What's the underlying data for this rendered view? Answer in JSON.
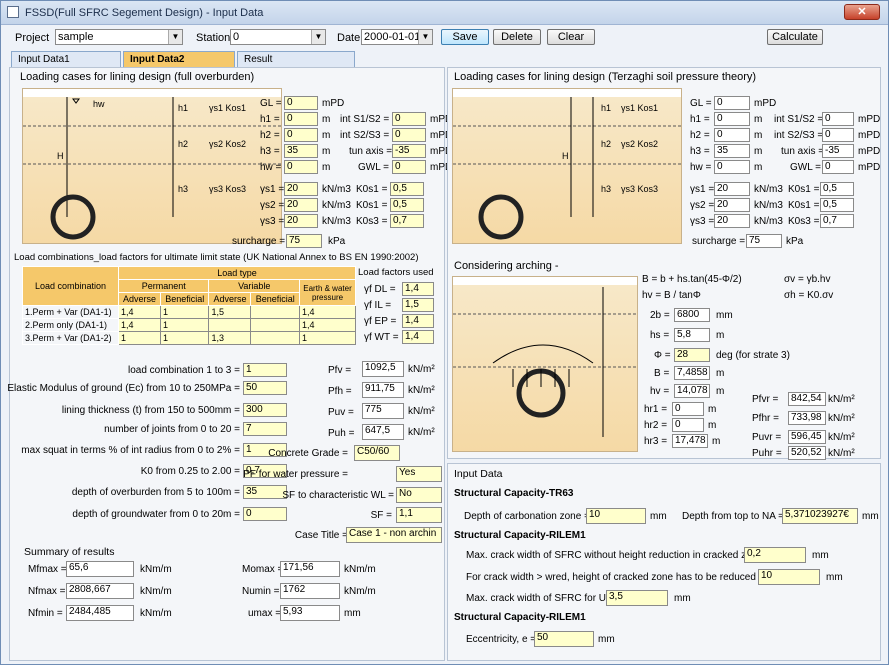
{
  "window": {
    "title": "FSSD(Full SFRC Segement Design) - Input Data",
    "close": "✕"
  },
  "toolbar": {
    "project_label": "Project",
    "project": "sample",
    "station_label": "Station",
    "station": "0",
    "date_label": "Date",
    "date": "2000-01-01",
    "save": "Save",
    "delete": "Delete",
    "clear": "Clear",
    "calculate": "Calculate"
  },
  "tabs": [
    "Input Data1",
    "Input Data2",
    "Result"
  ],
  "left": {
    "title": "Loading cases for lining design (full overburden)",
    "fields": [
      {
        "l": "GL =",
        "v": "0",
        "u": "mPD"
      },
      {
        "l": "h1 =",
        "v": "0",
        "u": "m"
      },
      {
        "l": "h2 =",
        "v": "0",
        "u": "m"
      },
      {
        "l": "h3 =",
        "v": "35",
        "u": "m"
      },
      {
        "l": "hw =",
        "v": "0",
        "u": "m"
      },
      {
        "l": "γs1 =",
        "v": "20",
        "u": "kN/m3"
      },
      {
        "l": "γs2 =",
        "v": "20",
        "u": "kN/m3"
      },
      {
        "l": "γs3 =",
        "v": "20",
        "u": "kN/m3"
      }
    ],
    "fields2": [
      {
        "l": "int S1/S2 =",
        "v": "0",
        "u": "mPD"
      },
      {
        "l": "int S2/S3 =",
        "v": "0",
        "u": "mPD"
      },
      {
        "l": "tun axis =",
        "v": "-35",
        "u": "mPD"
      },
      {
        "l": "GWL =",
        "v": "0",
        "u": "mPD"
      },
      {
        "l": "K0s1 =",
        "v": "0,5"
      },
      {
        "l": "K0s1 =",
        "v": "0,5"
      },
      {
        "l": "K0s3 =",
        "v": "0,7"
      }
    ],
    "surcharge_label": "surcharge =",
    "surcharge": "75",
    "surcharge_unit": "kPa",
    "diagram": {
      "H": "H",
      "h1": "h1",
      "h2": "h2",
      "h3": "h3",
      "hw": "hw",
      "g1": "γs1  Kos1",
      "g2": "γs2  Kos2",
      "g3": "γs3  Kos3"
    },
    "lc_title": "Load combinations_load factors for ultimate limit state (UK National Annex to BS EN 1990:2002)",
    "lc_head": {
      "combo": "Load combination",
      "type": "Load type",
      "perm": "Permanent",
      "var": "Variable",
      "ew": "Earth & water pressure",
      "adv": "Adverse",
      "ben": "Beneficial"
    },
    "lc_rows": [
      {
        "name": "1.Perm + Var (DA1-1)",
        "v": [
          "1,4",
          "1",
          "1,5",
          "",
          "1,4"
        ]
      },
      {
        "name": "2.Perm only (DA1-1)",
        "v": [
          "1,4",
          "1",
          "",
          "",
          "1,4"
        ]
      },
      {
        "name": "3.Perm + Var (DA1-2)",
        "v": [
          "1",
          "1",
          "1,3",
          "",
          "1"
        ]
      }
    ],
    "lf_title": "Load factors used",
    "lf": [
      {
        "l": "γf DL =",
        "v": "1,4"
      },
      {
        "l": "γf IL =",
        "v": "1,5"
      },
      {
        "l": "γf EP =",
        "v": "1,4"
      },
      {
        "l": "γf WT =",
        "v": "1,4"
      }
    ],
    "params": [
      {
        "l": "load combination 1 to 3 =",
        "v": "1"
      },
      {
        "l": "Elastic Modulus of ground (Ec) from 10 to 250MPa =",
        "v": "50"
      },
      {
        "l": "lining thickness (t) from 150 to 500mm =",
        "v": "300"
      },
      {
        "l": "number of joints from 0 to 20 =",
        "v": "7"
      },
      {
        "l": "max squat in terms % of int radius from 0 to 2% =",
        "v": "1"
      },
      {
        "l": "K0 from 0.25 to 2.00 =",
        "v": "0,7"
      },
      {
        "l": "depth of overburden from 5 to 100m =",
        "v": "35"
      },
      {
        "l": "depth of groundwater from 0 to 20m =",
        "v": "0"
      }
    ],
    "pres": [
      {
        "l": "Pfv =",
        "v": "1092,5",
        "u": "kN/m²"
      },
      {
        "l": "Pfh =",
        "v": "911,75",
        "u": "kN/m²"
      },
      {
        "l": "Puv =",
        "v": "775",
        "u": "kN/m²"
      },
      {
        "l": "Puh =",
        "v": "647,5",
        "u": "kN/m²"
      }
    ],
    "grade_label": "Concrete Grade =",
    "grade": "C50/60",
    "pf_label": "PF for water pressure =",
    "pf": "Yes",
    "sf_wl_label": "SF to characteristic WL =",
    "sf_wl": "No",
    "sf_label": "SF =",
    "sf": "1,1",
    "case_label": "Case Title =",
    "case": "Case 1 - non archin",
    "summary_title": "Summary of results",
    "summary": [
      {
        "l": "Mfmax =",
        "v": "65,6",
        "u": "kNm/m"
      },
      {
        "l": "Nfmax =",
        "v": "2808,667",
        "u": "kNm/m"
      },
      {
        "l": "Nfmin =",
        "v": "2484,485",
        "u": "kNm/m"
      },
      {
        "l": "Momax =",
        "v": "171,56",
        "u": "kNm/m"
      },
      {
        "l": "Numin =",
        "v": "1762",
        "u": "kNm/m"
      },
      {
        "l": "umax =",
        "v": "5,93",
        "u": "mm"
      }
    ]
  },
  "right": {
    "title": "Loading cases for lining design (Terzaghi soil pressure theory)",
    "fields": [
      {
        "l": "GL =",
        "v": "0",
        "u": "mPD"
      },
      {
        "l": "h1 =",
        "v": "0",
        "u": "m"
      },
      {
        "l": "h2 =",
        "v": "0",
        "u": "m"
      },
      {
        "l": "h3 =",
        "v": "35",
        "u": "m"
      },
      {
        "l": "hw =",
        "v": "0",
        "u": "m"
      },
      {
        "l": "γs1 =",
        "v": "20",
        "u": "kN/m3"
      },
      {
        "l": "γs2 =",
        "v": "20",
        "u": "kN/m3"
      },
      {
        "l": "γs3 =",
        "v": "20",
        "u": "kN/m3"
      }
    ],
    "fields2": [
      {
        "l": "int S1/S2 =",
        "v": "0",
        "u": "mPD"
      },
      {
        "l": "int S2/S3 =",
        "v": "0",
        "u": "mPD"
      },
      {
        "l": "tun axis =",
        "v": "-35",
        "u": "mPD"
      },
      {
        "l": "GWL =",
        "v": "0",
        "u": "mPD"
      },
      {
        "l": "K0s1 =",
        "v": "0,5"
      },
      {
        "l": "K0s1 =",
        "v": "0,5"
      },
      {
        "l": "K0s3 =",
        "v": "0,7"
      }
    ],
    "surcharge_label": "surcharge =",
    "surcharge": "75",
    "surcharge_unit": "kPa",
    "arch_title": "Considering arching -",
    "formulas": [
      "B = b + hs.tan(45-Φ/2)",
      "σv = γb.hv",
      "hv = B / tanΦ",
      "σh = K0.σv"
    ],
    "arch": [
      {
        "l": "2b =",
        "v": "6800",
        "u": "mm"
      },
      {
        "l": "hs =",
        "v": "5,8",
        "u": "m"
      },
      {
        "l": "Φ =",
        "v": "28",
        "u": "deg (for strate 3)"
      },
      {
        "l": "B =",
        "v": "7,4858",
        "u": "m"
      },
      {
        "l": "hv =",
        "v": "14,078",
        "u": "m"
      }
    ],
    "hr": [
      {
        "l": "hr1 =",
        "v": "0",
        "u": "m"
      },
      {
        "l": "hr2 =",
        "v": "0",
        "u": "m"
      },
      {
        "l": "hr3 =",
        "v": "17,478",
        "u": "m"
      }
    ],
    "pr": [
      {
        "l": "Pfvr =",
        "v": "842,54",
        "u": "kN/m²"
      },
      {
        "l": "Pfhr =",
        "v": "733,98",
        "u": "kN/m²"
      },
      {
        "l": "Puvr =",
        "v": "596,45",
        "u": "kN/m²"
      },
      {
        "l": "Puhr =",
        "v": "520,52",
        "u": "kN/m²"
      }
    ],
    "input_title": "Input Data",
    "sc1_title": "Structural Capacity-TR63",
    "carb_label": "Depth of carbonation zone =",
    "carb": "10",
    "carb_unit": "mm",
    "na_label": "Depth from top to NA =",
    "na": "5,371023927€",
    "na_unit": "mm",
    "sc2_title": "Structural Capacity-RILEM1",
    "crack1_label": "Max. crack width of SFRC without height reduction in cracked zone,",
    "crack1": "0,2",
    "crack1_unit": "mm",
    "crack2_label": "For crack width > wred, height of cracked zone has to be reduced by,",
    "crack2": "10",
    "crack2_unit": "mm",
    "crack3_label": "Max. crack width of SFRC for ULS,",
    "crack3": "3,5",
    "crack3_unit": "mm",
    "sc3_title": "Structural Capacity-RILEM1",
    "ecc_label": "Eccentricity, e =",
    "ecc": "50",
    "ecc_unit": "mm"
  }
}
